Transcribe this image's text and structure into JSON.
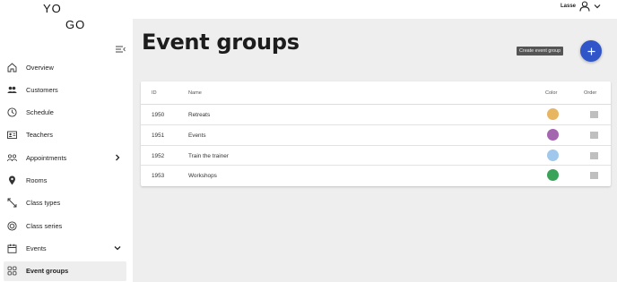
{
  "app": {
    "logo_line1": "YO",
    "logo_line2": "GO",
    "user_name": "Lasse"
  },
  "sidebar": {
    "items": [
      {
        "label": "Overview",
        "icon": "home-icon"
      },
      {
        "label": "Customers",
        "icon": "users-icon"
      },
      {
        "label": "Schedule",
        "icon": "clock-icon"
      },
      {
        "label": "Teachers",
        "icon": "id-card-icon"
      },
      {
        "label": "Appointments",
        "icon": "people-icon",
        "arrow": "right"
      },
      {
        "label": "Rooms",
        "icon": "location-pin-icon"
      },
      {
        "label": "Class types",
        "icon": "expand-arrows-icon"
      },
      {
        "label": "Class series",
        "icon": "rings-icon"
      },
      {
        "label": "Events",
        "icon": "calendar-icon",
        "arrow": "down"
      },
      {
        "label": "Event groups",
        "icon": "grid-icon",
        "active": true
      }
    ]
  },
  "main": {
    "title": "Event groups",
    "create_tooltip": "Create event group",
    "table": {
      "columns": {
        "id": "ID",
        "name": "Name",
        "color": "Color",
        "order": "Order"
      },
      "rows": [
        {
          "id": "1950",
          "name": "Retreats",
          "color": "#e8b561"
        },
        {
          "id": "1951",
          "name": "Events",
          "color": "#a566b0"
        },
        {
          "id": "1952",
          "name": "Train the trainer",
          "color": "#9fc8ec"
        },
        {
          "id": "1953",
          "name": "Workshops",
          "color": "#3aa35a"
        }
      ]
    }
  },
  "colors": {
    "accent": "#2f55c9",
    "main_bg": "#eeeeee"
  }
}
